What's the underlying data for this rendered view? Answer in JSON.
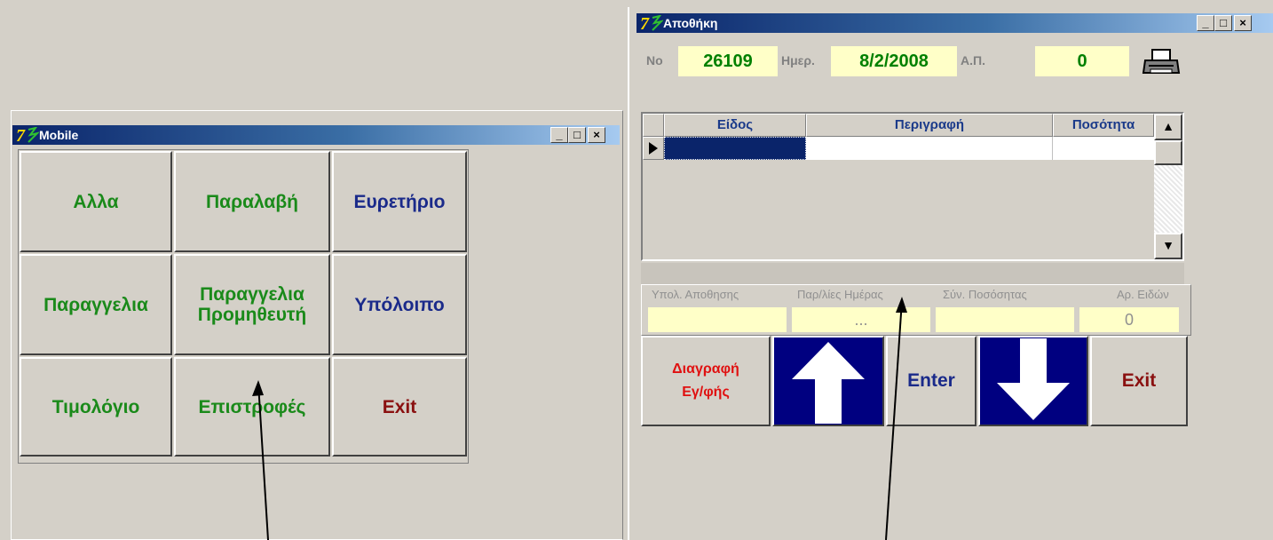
{
  "mobile_window": {
    "title": "Mobile",
    "buttons": [
      {
        "label": "Αλλα",
        "color": "#1a8a1a"
      },
      {
        "label": "Παραλαβή",
        "color": "#1a8a1a"
      },
      {
        "label": "Ευρετήριο",
        "color": "#1a2a8a"
      },
      {
        "label": "Παραγγελια",
        "color": "#1a8a1a"
      },
      {
        "label": "Παραγγελια Προμηθευτή",
        "color": "#1a8a1a"
      },
      {
        "label": "Υπόλοιπο",
        "color": "#1a2a8a"
      },
      {
        "label": "Τιμολόγιο",
        "color": "#1a8a1a"
      },
      {
        "label": "Επιστροφές",
        "color": "#1a8a1a"
      },
      {
        "label": "Exit",
        "color": "#8a1010"
      }
    ]
  },
  "warehouse_window": {
    "title": "Αποθήκη",
    "no_label": "No",
    "no_value": "26109",
    "date_label": "Ημερ.",
    "date_value": "8/2/2008",
    "ap_label": "Α.Π.",
    "ap_value": "0",
    "printer_icon": "printer-icon",
    "grid": {
      "columns": [
        "Είδος",
        "Περιγραφή",
        "Ποσότητα"
      ]
    },
    "info": {
      "stock_label": "Υπολ. Αποθησης",
      "day_orders_label": "Παρ/λίες Ημέρας",
      "day_orders_value": "...",
      "total_qty_label": "Σύν. Ποσόσητας",
      "item_count_label": "Αρ. Ειδών",
      "item_count_value": "0"
    },
    "buttons": {
      "delete_label_1": "Διαγραφή",
      "delete_label_2": "Εγ/φής",
      "enter_label": "Enter",
      "exit_label": "Exit"
    }
  },
  "colors": {
    "titlebar_start": "#0a246a",
    "titlebar_end": "#a6caf0",
    "field_bg": "#ffffc8",
    "arrow_bg": "#000080"
  }
}
